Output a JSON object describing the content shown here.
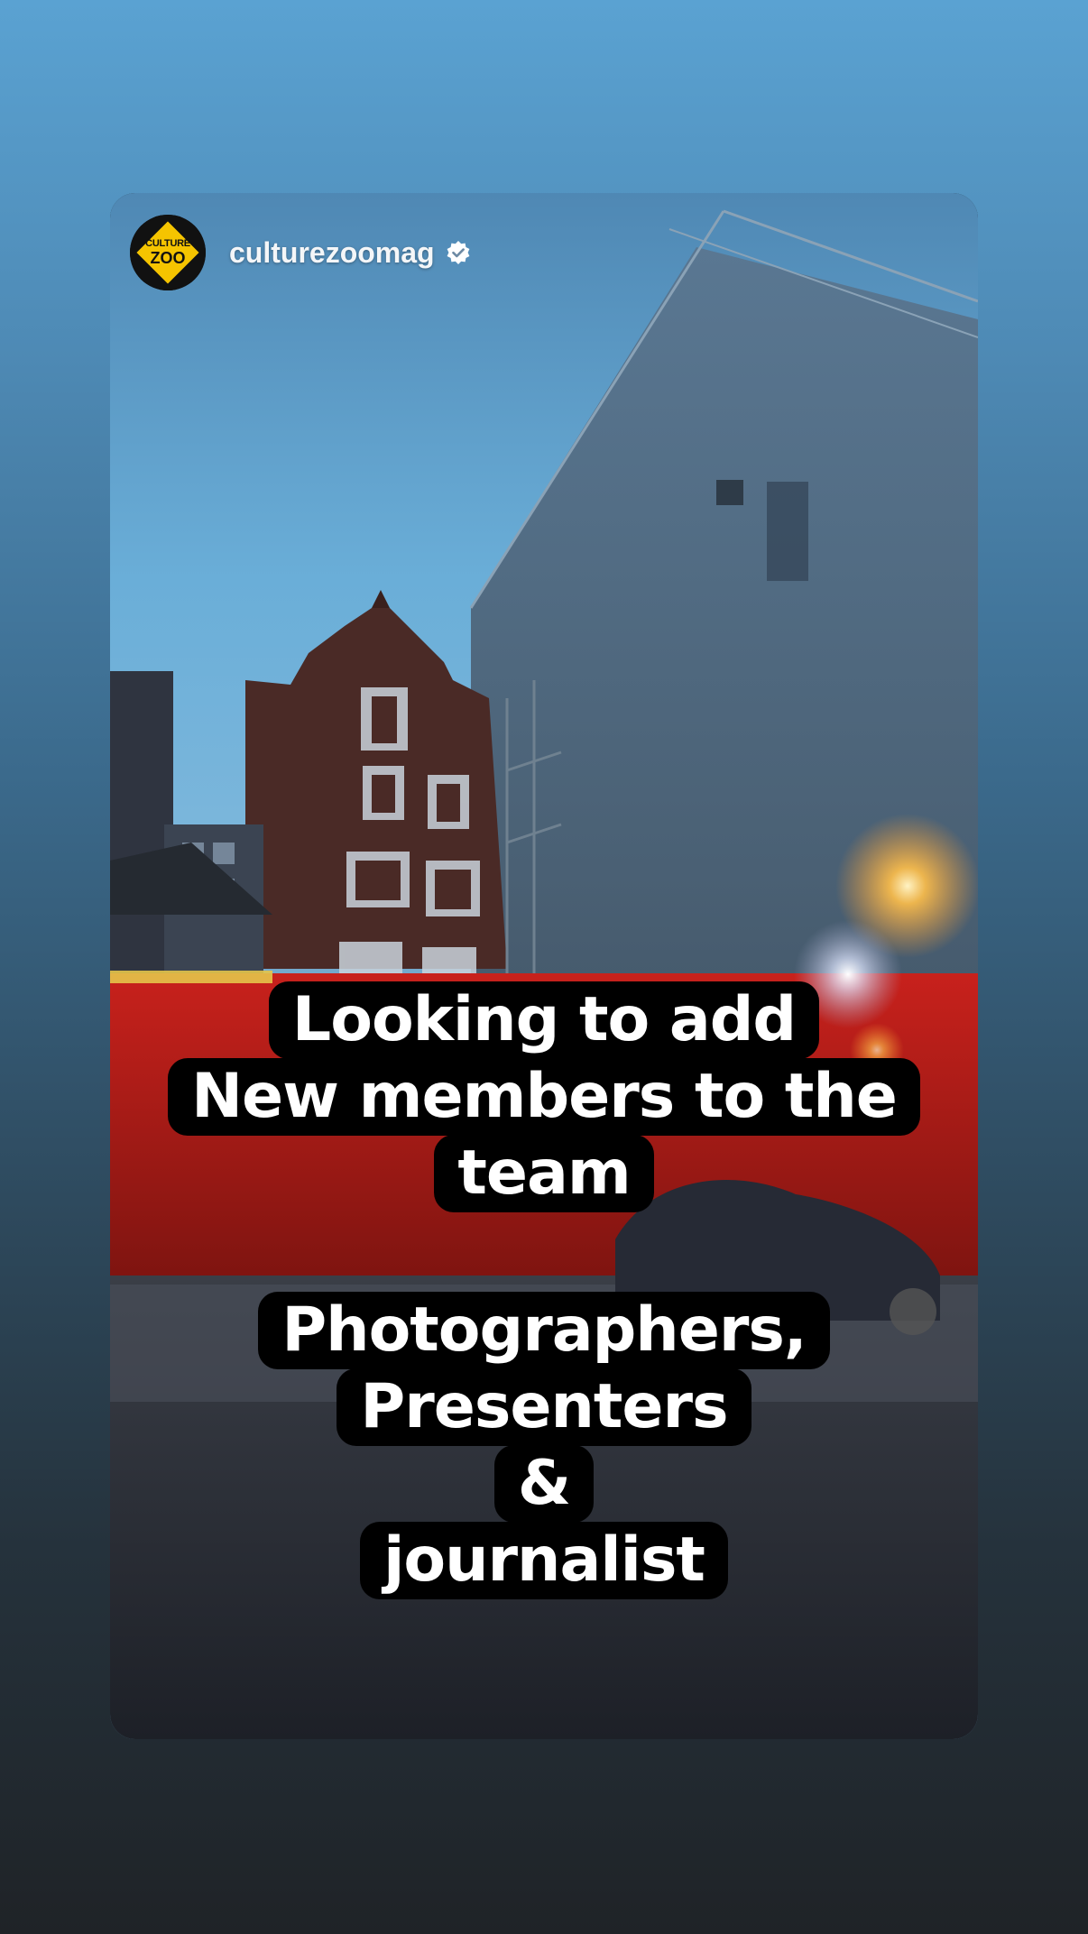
{
  "account": {
    "username": "culturezoomag",
    "verified": true,
    "logo_text_top": "CULTURE",
    "logo_text_bottom": "ZOO"
  },
  "caption": {
    "block1": [
      "Looking to add",
      "New members to the",
      "team"
    ],
    "block2": [
      "Photographers,",
      "Presenters",
      "&",
      "journalist"
    ]
  },
  "colors": {
    "logo_yellow": "#f5c400",
    "verified": "#ffffff",
    "caption_bg": "#000000",
    "caption_text": "#ffffff"
  },
  "icons": [
    "culture-zoo-logo-icon",
    "verified-badge-icon"
  ]
}
